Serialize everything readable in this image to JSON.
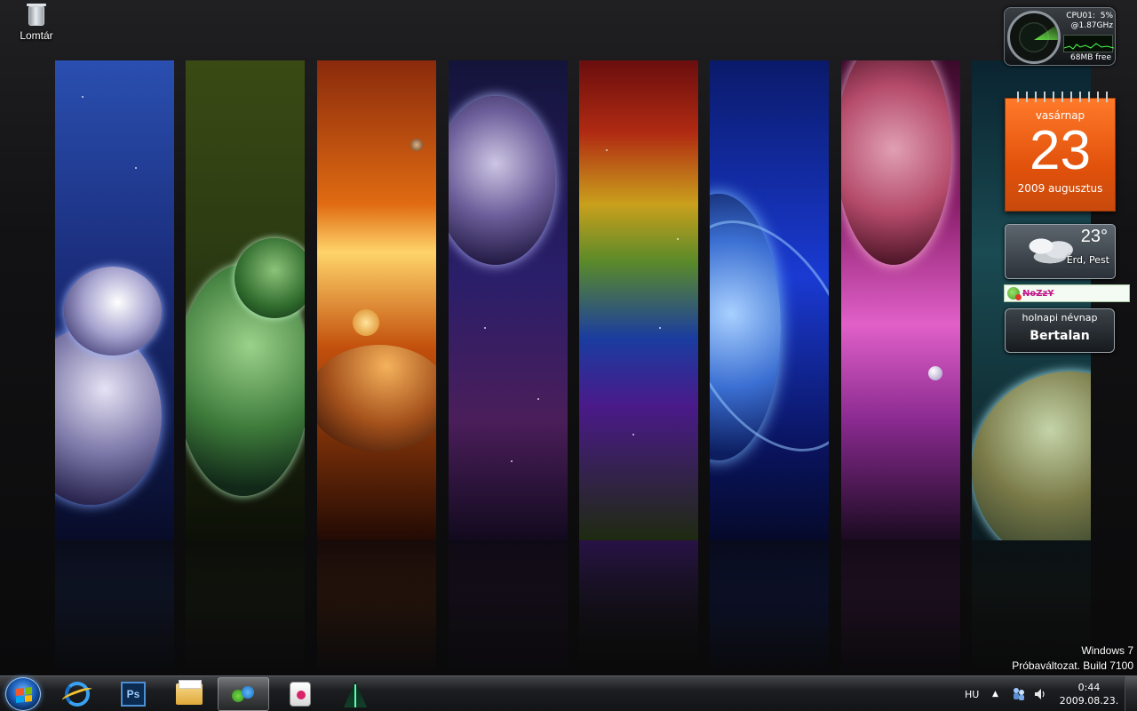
{
  "desktop": {
    "icons": [
      {
        "label": "Lomtár",
        "icon": "recycle-bin-icon"
      }
    ],
    "wallpaper": "planet-panels-space-wallpaper"
  },
  "gadgets": {
    "cpu_meter": {
      "cpu_label": "CPU01:",
      "cpu_percent": "5%",
      "cpu_speed": "@1.87GHz",
      "memory": "68MB free"
    },
    "calendar": {
      "day_name": "vasárnap",
      "day": "23",
      "month_year": "2009 augusztus",
      "accent": "#e8580f"
    },
    "weather": {
      "temperature": "23°",
      "location": "Érd, Pest"
    },
    "messenger": {
      "name": "NoZzY"
    },
    "nameday": {
      "title": "holnapi névnap",
      "name": "Bertalan"
    }
  },
  "watermark": {
    "line1": "Windows 7",
    "line2": "Próbaváltozat. Build 7100"
  },
  "taskbar": {
    "start_icon": "windows-start-orb-icon",
    "pinned": [
      {
        "name": "internet-explorer",
        "icon": "internet-explorer-icon",
        "active": false
      },
      {
        "name": "photoshop",
        "label": "Ps",
        "icon": "photoshop-icon",
        "active": false
      },
      {
        "name": "windows-explorer",
        "icon": "folder-icon",
        "active": false
      },
      {
        "name": "windows-live-messenger",
        "icon": "messenger-icon",
        "active": true
      },
      {
        "name": "wireless-app",
        "icon": "wireless-icon",
        "active": false
      },
      {
        "name": "tree-app",
        "icon": "tree-icon",
        "active": false
      }
    ],
    "tray": {
      "language": "HU",
      "show_hidden": "▲",
      "clock_time": "0:44",
      "clock_date": "2009.08.23."
    }
  }
}
